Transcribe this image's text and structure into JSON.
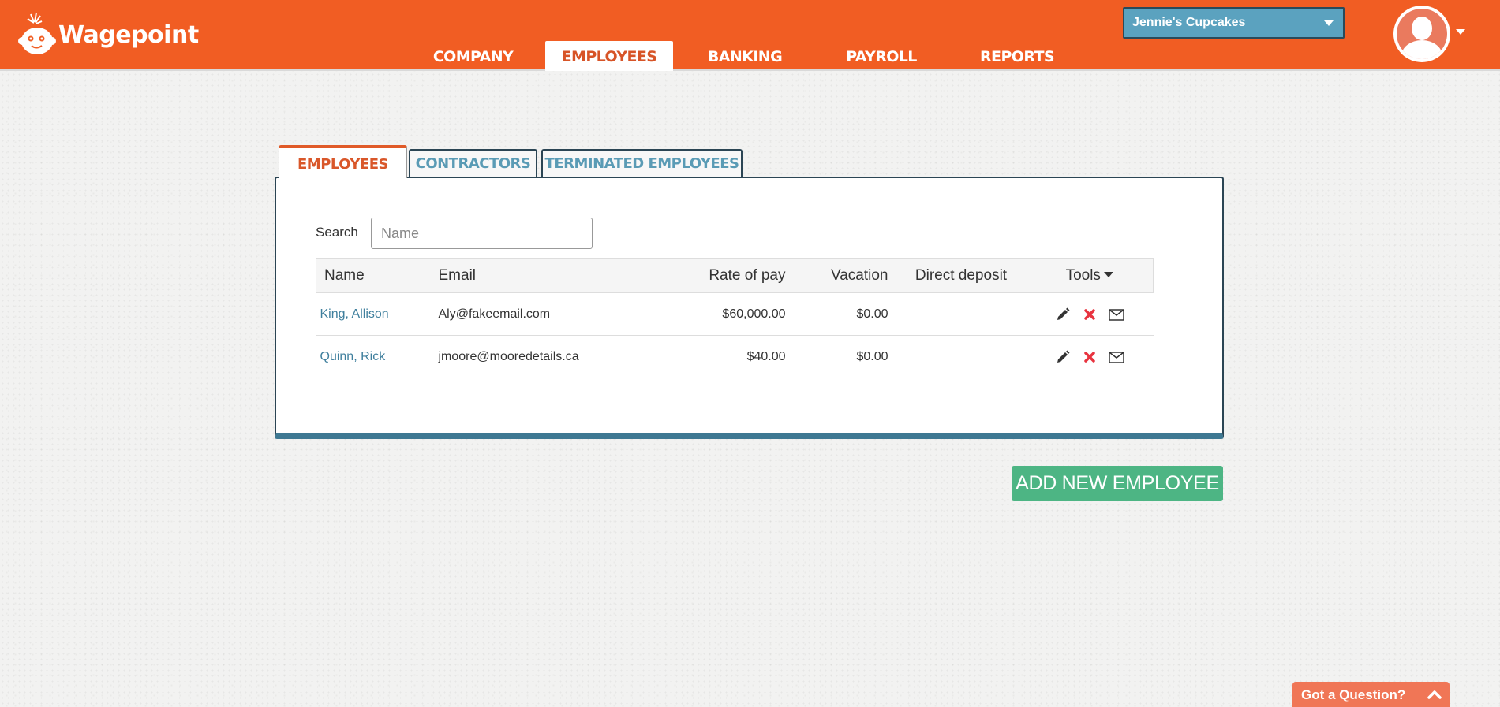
{
  "app": {
    "brand": "Wagepoint"
  },
  "colors": {
    "header": "#f15d23",
    "accent_blue": "#5ba2bf",
    "link": "#3f7f9d",
    "success": "#4db584",
    "danger": "#e8333f"
  },
  "nav": {
    "items": [
      {
        "label": "COMPANY",
        "active": false
      },
      {
        "label": "EMPLOYEES",
        "active": true
      },
      {
        "label": "BANKING",
        "active": false
      },
      {
        "label": "PAYROLL",
        "active": false
      },
      {
        "label": "REPORTS",
        "active": false
      }
    ]
  },
  "company_select": {
    "value": "Jennie's Cupcakes"
  },
  "tabs": [
    {
      "label": "EMPLOYEES",
      "active": true
    },
    {
      "label": "CONTRACTORS",
      "active": false
    },
    {
      "label": "TERMINATED EMPLOYEES",
      "active": false
    }
  ],
  "search": {
    "label": "Search",
    "placeholder": "Name",
    "value": ""
  },
  "table": {
    "columns": [
      "Name",
      "Email",
      "Rate of pay",
      "Vacation",
      "Direct deposit",
      "Tools"
    ],
    "rows": [
      {
        "name": "King, Allison",
        "email": "Aly@fakeemail.com",
        "rate": "$60,000.00",
        "vacation": "$0.00",
        "direct_deposit": "",
        "tools": [
          "pencil-icon",
          "delete-x-icon",
          "envelope-icon"
        ]
      },
      {
        "name": "Quinn, Rick",
        "email": "jmoore@mooredetails.ca",
        "rate": "$40.00",
        "vacation": "$0.00",
        "direct_deposit": "",
        "tools": [
          "pencil-icon",
          "delete-x-icon",
          "envelope-icon"
        ]
      }
    ]
  },
  "actions": {
    "add_employee": "ADD NEW EMPLOYEE"
  },
  "help_widget": {
    "label": "Got a Question?"
  }
}
